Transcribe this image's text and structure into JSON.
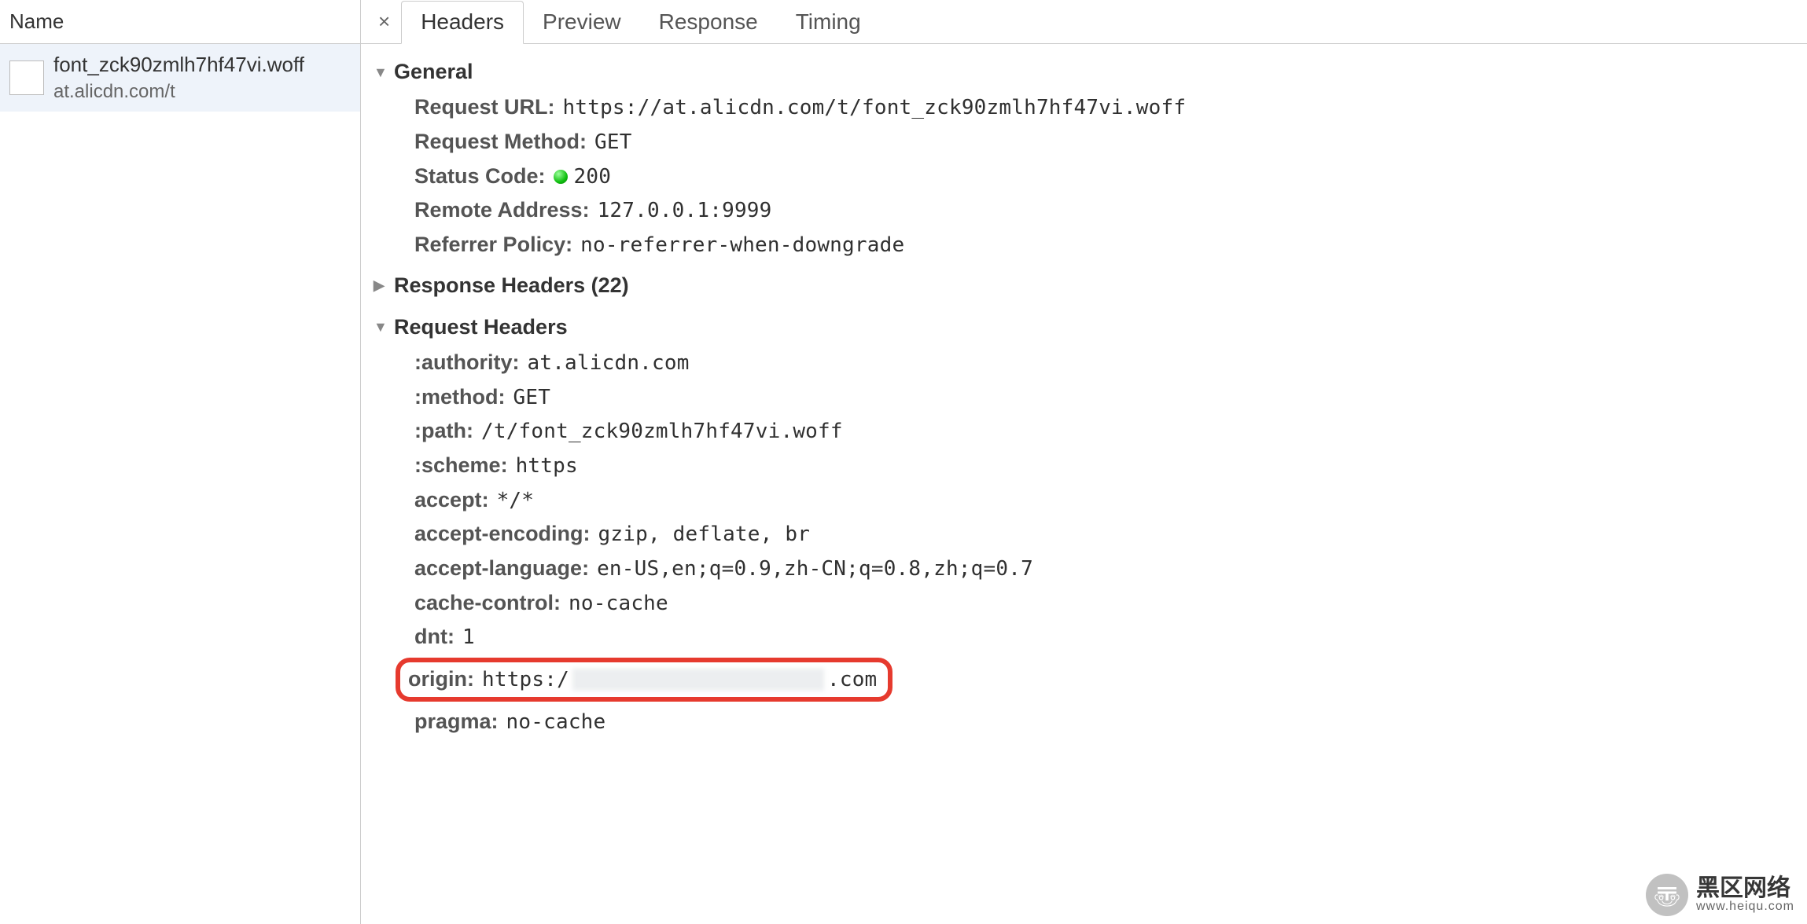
{
  "left": {
    "header": "Name",
    "items": [
      {
        "name": "font_zck90zmlh7hf47vi.woff",
        "domain": "at.alicdn.com/t"
      }
    ]
  },
  "tabs": {
    "close_glyph": "×",
    "items": [
      {
        "label": "Headers",
        "active": true
      },
      {
        "label": "Preview",
        "active": false
      },
      {
        "label": "Response",
        "active": false
      },
      {
        "label": "Timing",
        "active": false
      }
    ]
  },
  "sections": {
    "general": {
      "title": "General",
      "open": true,
      "rows": [
        {
          "key": "Request URL",
          "val": "https://at.alicdn.com/t/font_zck90zmlh7hf47vi.woff"
        },
        {
          "key": "Request Method",
          "val": "GET"
        },
        {
          "key": "Status Code",
          "val": "200",
          "status_dot": true
        },
        {
          "key": "Remote Address",
          "val": "127.0.0.1:9999"
        },
        {
          "key": "Referrer Policy",
          "val": "no-referrer-when-downgrade"
        }
      ]
    },
    "response_headers": {
      "title": "Response Headers (22)",
      "open": false
    },
    "request_headers": {
      "title": "Request Headers",
      "open": true,
      "rows": [
        {
          "key": ":authority",
          "val": "at.alicdn.com"
        },
        {
          "key": ":method",
          "val": "GET"
        },
        {
          "key": ":path",
          "val": "/t/font_zck90zmlh7hf47vi.woff"
        },
        {
          "key": ":scheme",
          "val": "https"
        },
        {
          "key": "accept",
          "val": "*/*"
        },
        {
          "key": "accept-encoding",
          "val": "gzip, deflate, br"
        },
        {
          "key": "accept-language",
          "val": "en-US,en;q=0.9,zh-CN;q=0.8,zh;q=0.7"
        },
        {
          "key": "cache-control",
          "val": "no-cache"
        },
        {
          "key": "dnt",
          "val": "1"
        },
        {
          "key": "origin",
          "val_prefix": "https:/",
          "val_suffix": ".com",
          "highlighted": true,
          "redacted": true
        },
        {
          "key": "pragma",
          "val": "no-cache"
        }
      ]
    }
  },
  "watermark": {
    "title": "黑区网络",
    "sub": "www.heiqu.com",
    "glyph": "〠"
  }
}
